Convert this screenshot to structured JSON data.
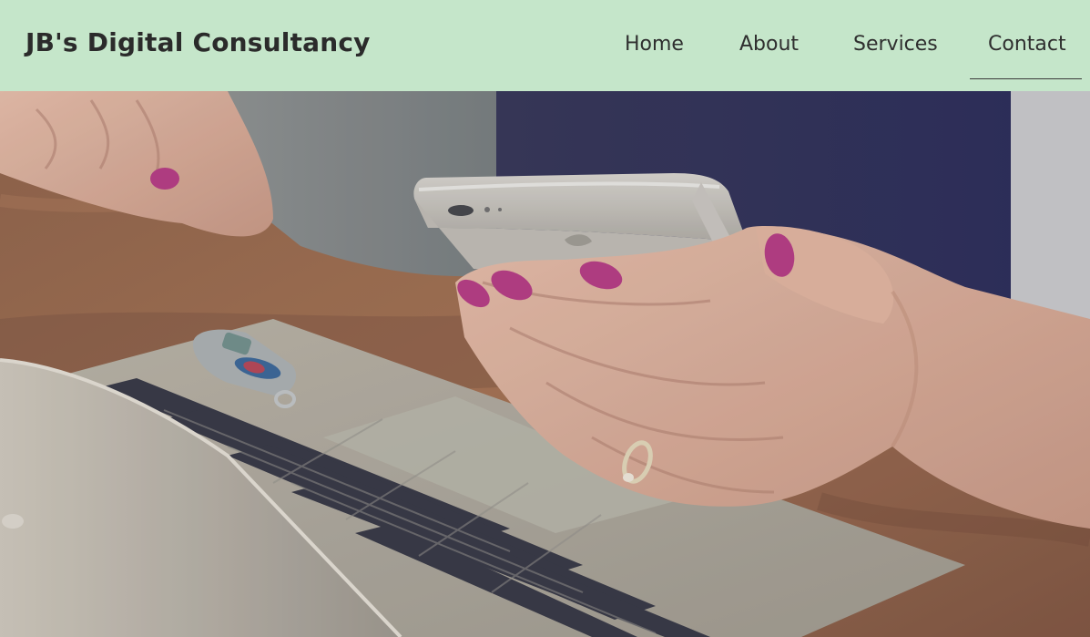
{
  "header": {
    "brand": "JB's Digital Consultancy",
    "nav": [
      {
        "label": "Home",
        "active": false
      },
      {
        "label": "About",
        "active": false
      },
      {
        "label": "Services",
        "active": false
      },
      {
        "label": "Contact",
        "active": true
      }
    ]
  },
  "colors": {
    "navbar_bg": "#c5e6ca",
    "text": "#2b2b2b",
    "nail_polish": "#b4307e"
  },
  "hero": {
    "image_icon": "hero-photo-hands-phone-laptop"
  }
}
